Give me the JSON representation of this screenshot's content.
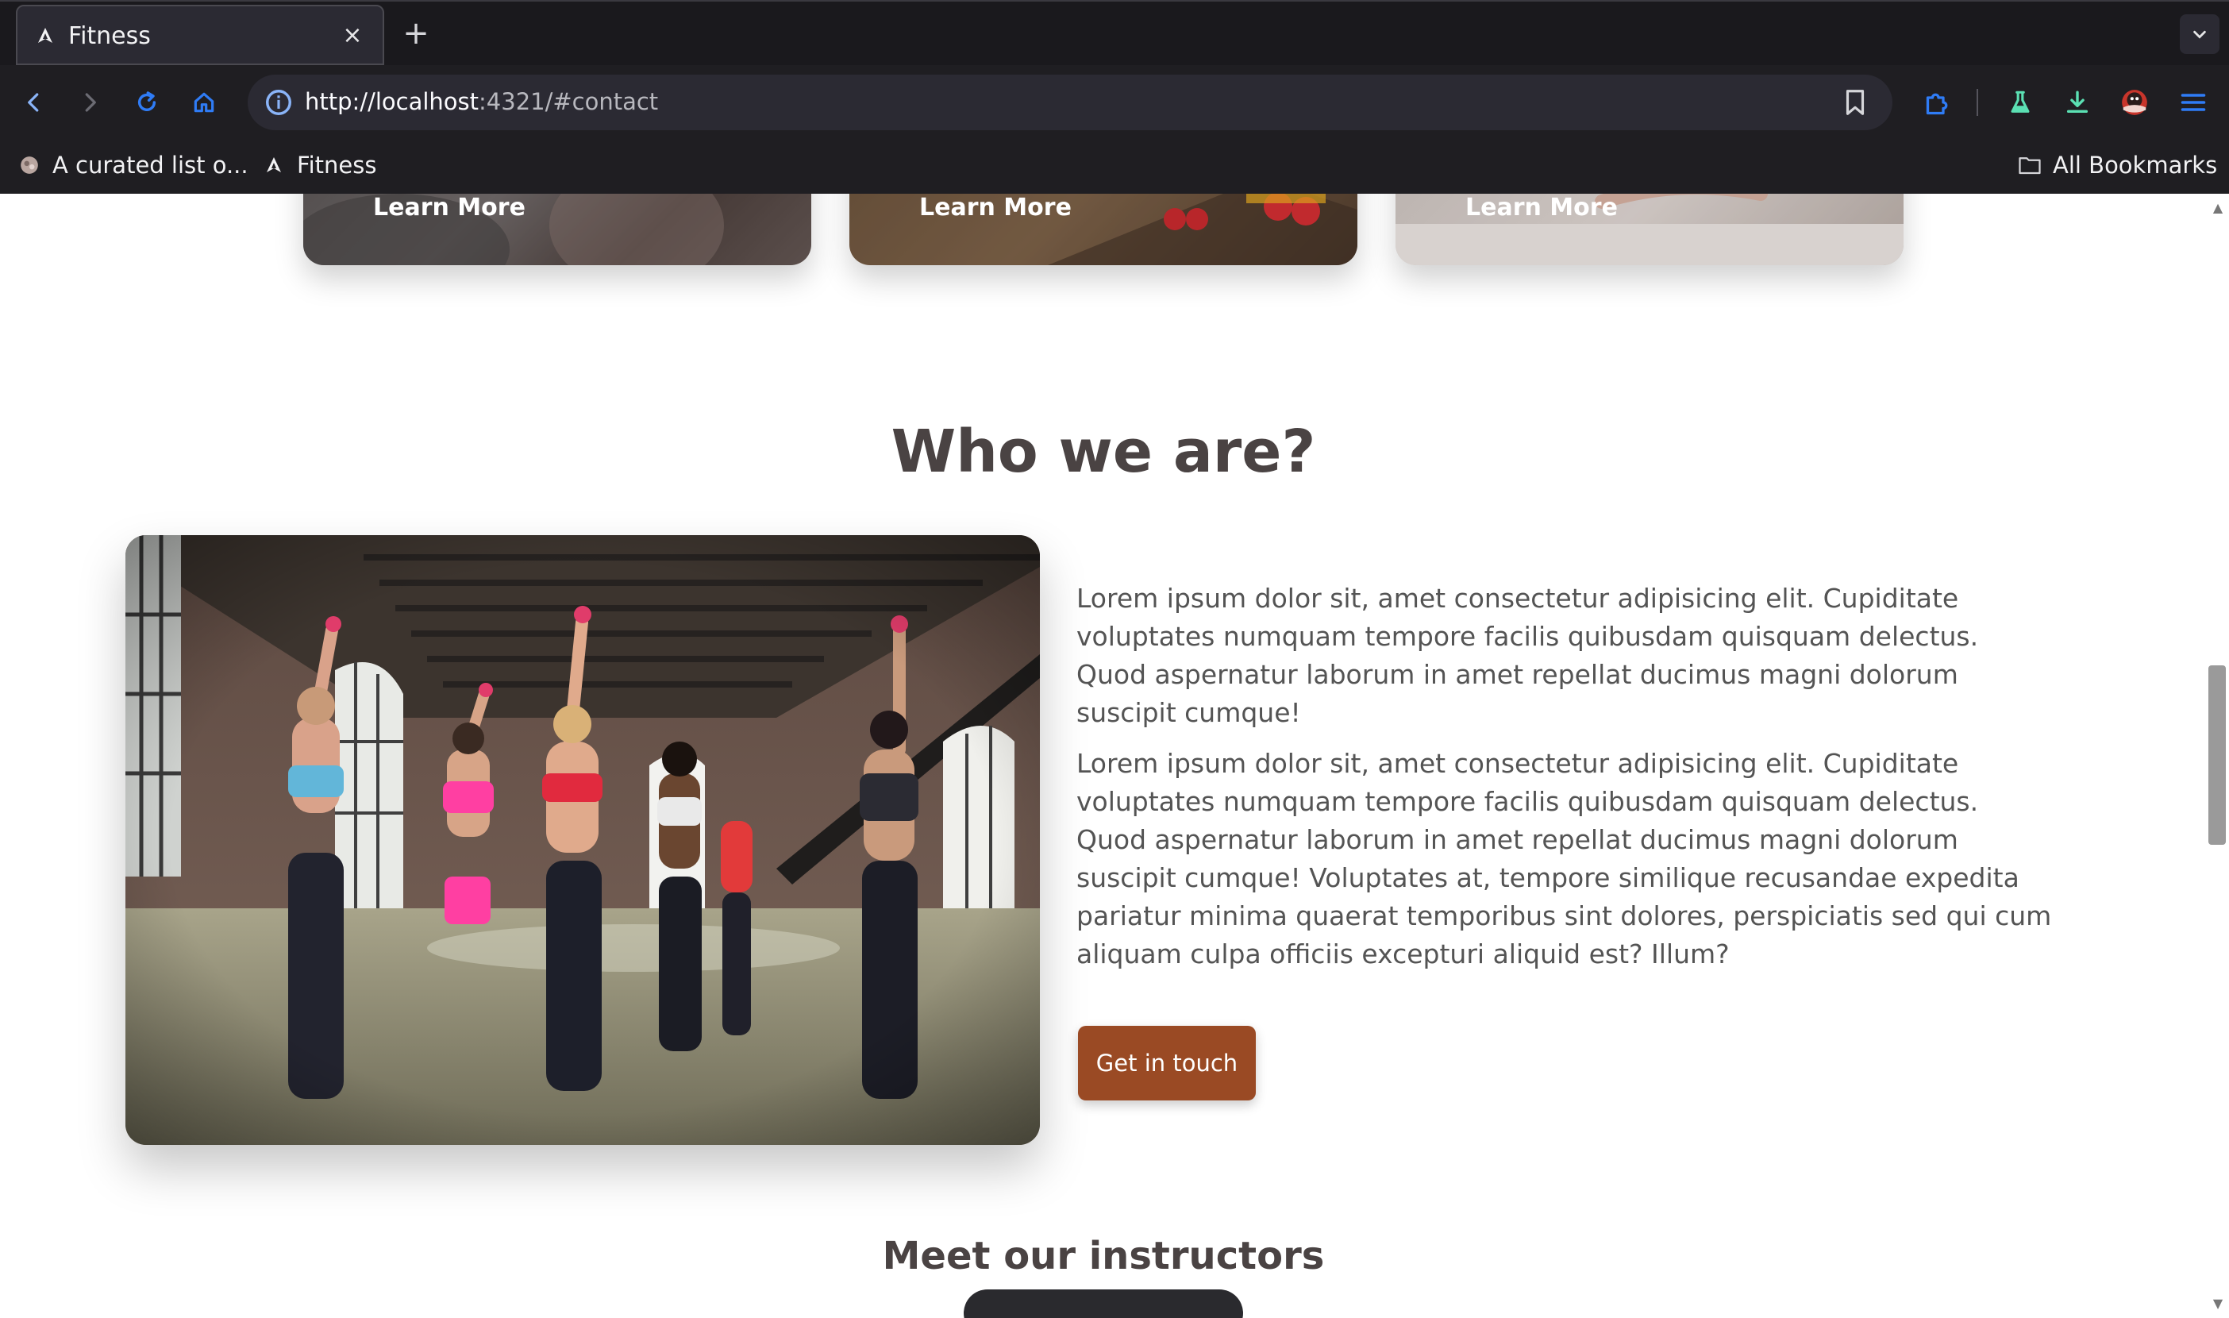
{
  "browser": {
    "tab": {
      "title": "Fitness",
      "close": "×"
    },
    "new_tab": "+",
    "url": {
      "host": "http://localhost",
      "rest": ":4321/#contact"
    },
    "bookmarks": [
      {
        "label": "A curated list o..."
      },
      {
        "label": "Fitness"
      }
    ],
    "all_bookmarks": "All Bookmarks"
  },
  "cards": [
    {
      "button": "Learn More"
    },
    {
      "button": "Learn More"
    },
    {
      "button": "Learn More"
    }
  ],
  "about": {
    "title": "Who we are?",
    "paragraph1": "Lorem ipsum dolor sit, amet consectetur adipisicing elit. Cupiditate voluptates numquam tempore facilis quibusdam quisquam delectus. Quod aspernatur laborum in amet repellat ducimus magni dolorum suscipit cumque!",
    "paragraph2": "Lorem ipsum dolor sit, amet consectetur adipisicing elit. Cupiditate voluptates numquam tempore facilis quibusdam quisquam delectus. Quod aspernatur laborum in amet repellat ducimus magni dolorum suscipit cumque! Voluptates at, tempore similique recusandae expedita pariatur minima quaerat temporibus sint dolores, perspiciatis sed qui cum aliquam culpa officiis excepturi aliquid est? Illum?",
    "cta": "Get in touch"
  },
  "instructors": {
    "title": "Meet our instructors"
  },
  "colors": {
    "accent": "#9a4a24",
    "heading": "#4a4343",
    "chrome": "#1f1e22"
  }
}
